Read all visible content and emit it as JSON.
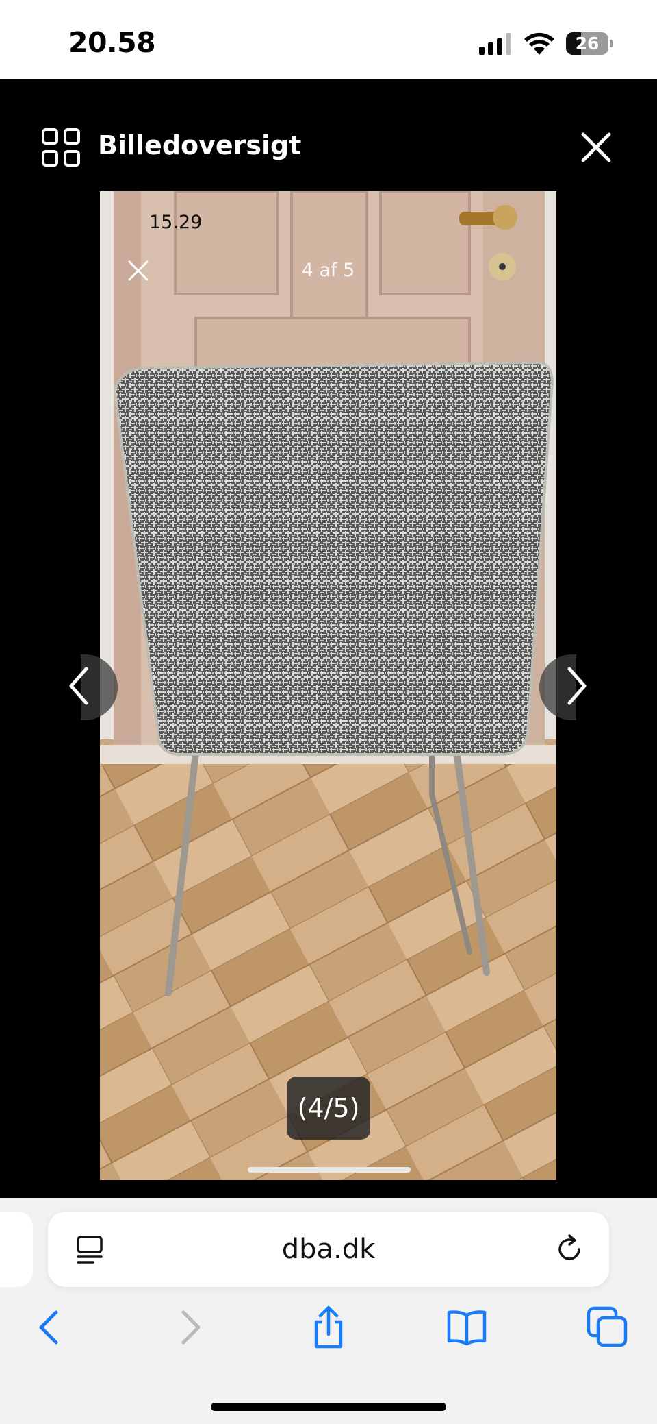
{
  "status_bar": {
    "time": "20.58",
    "battery": "26"
  },
  "viewer": {
    "title": "Billedoversigt",
    "image_count": "(4/5)"
  },
  "photo": {
    "embedded_time": "15.29",
    "embedded_counter": "4 af 5"
  },
  "browser": {
    "address": "dba.dk"
  },
  "colors": {
    "accent": "#1a7cf5",
    "disabled": "#b8b8bd"
  },
  "icons": [
    "grid-icon",
    "close-icon",
    "chevron-left-icon",
    "chevron-right-icon",
    "reader-icon",
    "reload-icon",
    "back-icon",
    "forward-icon",
    "share-icon",
    "bookmarks-icon",
    "tabs-icon"
  ]
}
